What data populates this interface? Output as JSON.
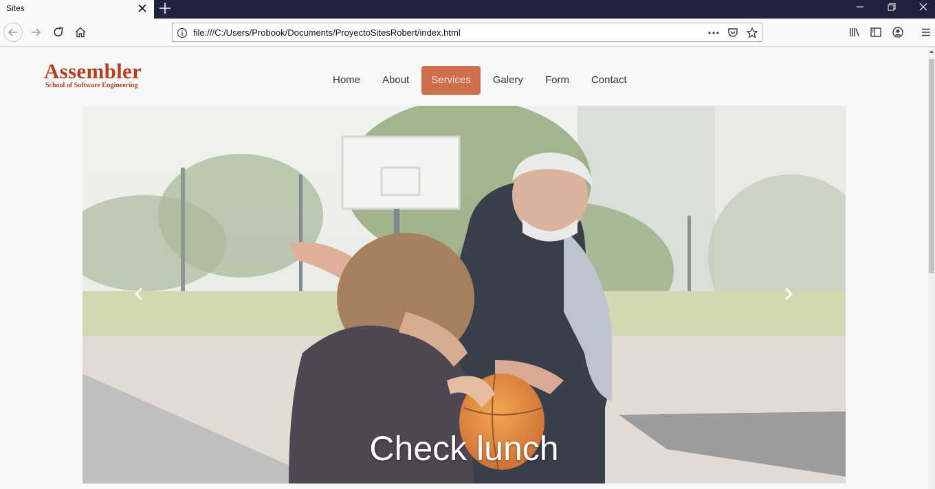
{
  "browser": {
    "tab_title": "Sites",
    "url": "file:///C:/Users/Probook/Documents/ProyectoSitesRobert/index.html"
  },
  "site": {
    "logo_name": "Assembler",
    "logo_tagline": "School of Software Engineering",
    "menu": [
      {
        "label": "Home",
        "active": false
      },
      {
        "label": "About",
        "active": false
      },
      {
        "label": "Services",
        "active": true
      },
      {
        "label": "Galery",
        "active": false
      },
      {
        "label": "Form",
        "active": false
      },
      {
        "label": "Contact",
        "active": false
      }
    ]
  },
  "carousel": {
    "caption": "Check lunch",
    "prev_icon": "chevron-left-icon",
    "next_icon": "chevron-right-icon"
  },
  "colors": {
    "brand": "#b5401c",
    "active_menu_bg": "#cf6e4d",
    "titlebar": "#202340"
  }
}
